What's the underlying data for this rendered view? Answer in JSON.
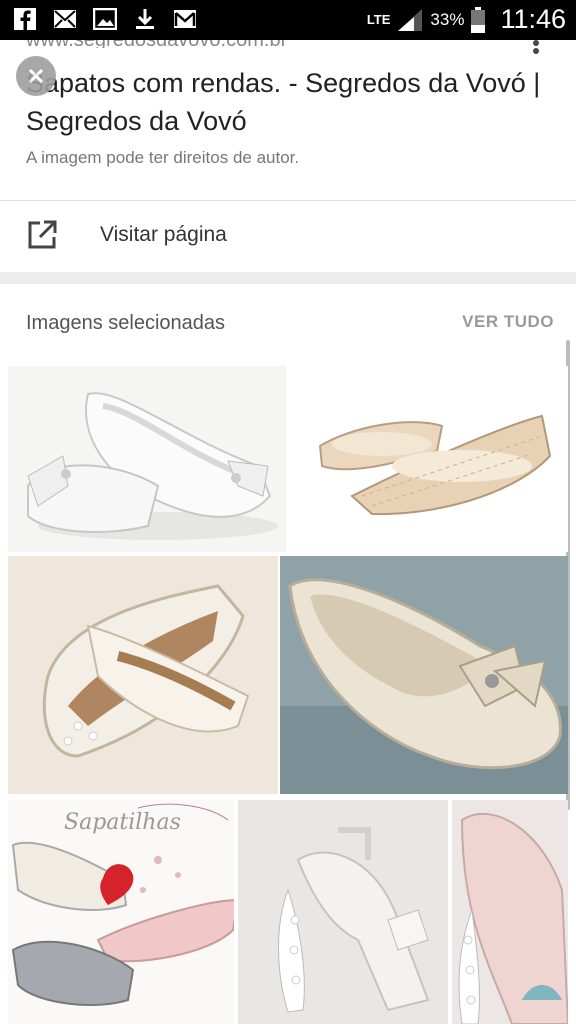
{
  "status_bar": {
    "network": "LTE",
    "battery": "33%",
    "time": "11:46"
  },
  "result": {
    "url": "www.segredosdavovo.com.br",
    "title": "Sapatos com rendas. - Segredos da Vovó | Segredos da Vovó",
    "copyright_notice": "A imagem pode ter direitos de autor.",
    "visit_label": "Visitar página"
  },
  "selected_images": {
    "heading": "Imagens selecionadas",
    "see_all": "VER TUDO",
    "sapatilhas_caption": "Sapatilhas"
  }
}
